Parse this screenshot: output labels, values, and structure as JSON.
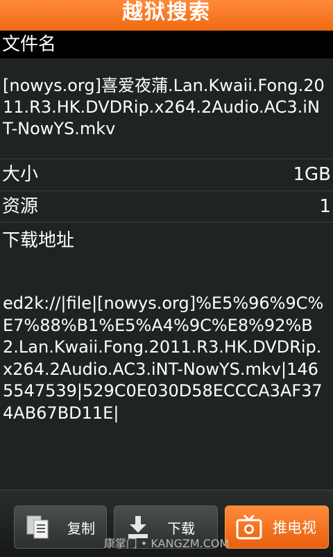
{
  "app": {
    "title": "越狱搜索"
  },
  "section": {
    "filename_header": "文件名"
  },
  "file": {
    "name": "[nowys.org]喜爱夜蒲.Lan.Kwaii.Fong.2011.R3.HK.DVDRip.x264.2Audio.AC3.iNT-NowYS.mkv",
    "size_label": "大小",
    "size_value": "1GB",
    "sources_label": "资源",
    "sources_value": "1",
    "link_label": "下载地址",
    "link_value": "ed2k://|file|[nowys.org]%E5%96%9C%E7%88%B1%E5%A4%9C%E8%92%B2.Lan.Kwaii.Fong.2011.R3.HK.DVDRip.x264.2Audio.AC3.iNT-NowYS.mkv|1465547539|529C0E030D58ECCCA3AF374AB67BD11E|"
  },
  "toolbar": {
    "copy_label": "复制",
    "download_label": "下载",
    "tv_label": "推电视"
  },
  "watermark": "康掌门 • KANGZM.COM",
  "colors": {
    "accent": "#f06a12",
    "background": "#1f2421"
  },
  "icons": [
    "copy-icon",
    "download-icon",
    "tv-icon"
  ]
}
